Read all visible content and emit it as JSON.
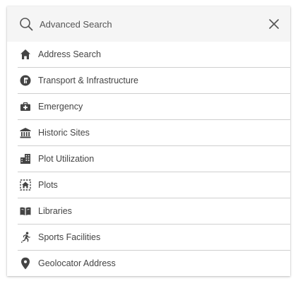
{
  "header": {
    "title": "Advanced Search",
    "search_icon": "search-icon",
    "close_icon": "close-icon"
  },
  "items": [
    {
      "label": "Address Search",
      "icon": "home-icon"
    },
    {
      "label": "Transport & Infrastructure",
      "icon": "transport-icon"
    },
    {
      "label": "Emergency",
      "icon": "medical-kit-icon"
    },
    {
      "label": "Historic Sites",
      "icon": "museum-icon"
    },
    {
      "label": "Plot Utilization",
      "icon": "buildings-icon"
    },
    {
      "label": "Plots",
      "icon": "plot-icon"
    },
    {
      "label": "Libraries",
      "icon": "book-icon"
    },
    {
      "label": "Sports Facilities",
      "icon": "running-icon"
    },
    {
      "label": "Geolocator Address",
      "icon": "location-pin-icon"
    }
  ],
  "colors": {
    "icon": "#444444",
    "header_bg": "#f5f5f5",
    "divider": "#cfcfcf"
  }
}
